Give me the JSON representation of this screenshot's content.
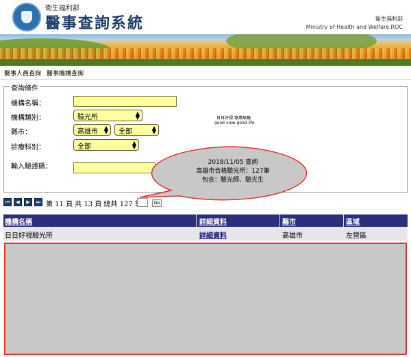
{
  "header": {
    "ministry_cn": "衛生福利部",
    "system_title": "醫事查詢系統",
    "ministry_right_cn": "衛生福利部",
    "ministry_right_en": "Ministry of Health and Welfare,ROC"
  },
  "nav": {
    "items": [
      "醫事人員查詢",
      "醫事機構查詢"
    ]
  },
  "query": {
    "legend": "查詢條件",
    "fields": {
      "name_label": "機構名稱：",
      "name_value": "",
      "type_label": "機構類別：",
      "type_selected": "驗光所",
      "city_label": "縣市：",
      "city_selected": "高雄市",
      "district_selected": "全部",
      "dept_label": "診療科別：",
      "dept_selected": "全部",
      "captcha_label": "輸入驗證碼：",
      "captcha_value": ""
    },
    "note_line1": "日日好視 專業眼鏡",
    "note_line2": "good view good life"
  },
  "callout": {
    "line1": "2018/11/05 查詢",
    "line2": "高雄市合格驗光所：127筆",
    "line3": "包含：驗光師、驗光生",
    "border_color": "#d33"
  },
  "pager": {
    "buttons": [
      "first-page",
      "prev-page",
      "next-page",
      "last-page"
    ],
    "text": "第 11 頁 共 13 頁 總共 127 筆",
    "page_input": "",
    "go_label": "Go"
  },
  "table": {
    "headers": [
      "機構名稱",
      "詳細資料",
      "縣市",
      "區域"
    ],
    "rows": [
      {
        "name": "日日好視驗光所",
        "detail": "詳細資料",
        "city": "高雄市",
        "district": "左營區"
      }
    ]
  },
  "colors": {
    "header_bar": "#2c2f7a",
    "input_bg": "#ffffa0",
    "highlight_border": "#e33"
  }
}
